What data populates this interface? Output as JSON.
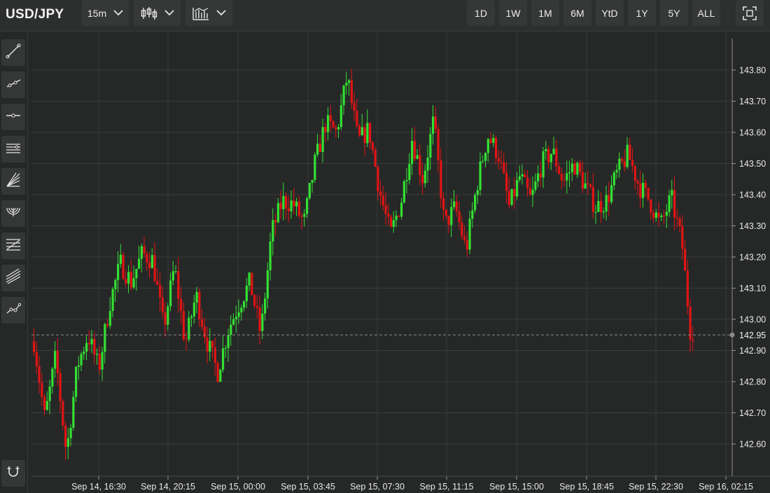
{
  "header": {
    "symbol": "USD/JPY",
    "interval": "15m",
    "chart_type_icon": "candlestick-icon",
    "indicators_icon": "indicators-icon",
    "ranges": [
      "1D",
      "1W",
      "1M",
      "6M",
      "YtD",
      "1Y",
      "5Y",
      "ALL"
    ],
    "fullscreen_icon": "fullscreen-icon"
  },
  "sidebar": {
    "tools": [
      "trend-line-icon",
      "ray-icon",
      "horizontal-line-icon",
      "parallel-channel-icon",
      "fan-icon",
      "arc-icon",
      "fib-retracement-icon",
      "pitchfork-icon",
      "path-icon"
    ],
    "bottom_tool": "magnet-icon"
  },
  "colors": {
    "background": "#262827",
    "up": "#33e033",
    "down": "#e01414",
    "grid": "#3b3d3c",
    "last_price_line": "#8a8a8a"
  },
  "chart_data": {
    "type": "candlestick",
    "symbol": "USD/JPY",
    "interval": "15m",
    "y_ticks": [
      "143.80",
      "143.70",
      "143.60",
      "143.50",
      "143.40",
      "143.30",
      "143.20",
      "143.10",
      "143.00",
      "142.90",
      "142.80",
      "142.70",
      "142.60"
    ],
    "ylim": [
      142.525,
      143.905
    ],
    "last_price": "142.95",
    "x_ticks": [
      "Sep 14, 16:30",
      "Sep 14, 20:15",
      "Sep 15, 00:00",
      "Sep 15, 03:45",
      "Sep 15, 07:30",
      "Sep 15, 11:15",
      "Sep 15, 15:00",
      "Sep 15, 18:45",
      "Sep 15, 22:30",
      "Sep 16, 02:15"
    ],
    "close_path": [
      142.93,
      142.68,
      142.88,
      142.57,
      142.85,
      142.95,
      142.84,
      143.05,
      143.18,
      143.12,
      143.21,
      143.19,
      142.97,
      143.17,
      142.92,
      143.08,
      142.93,
      142.83,
      142.97,
      143.05,
      143.12,
      142.95,
      143.28,
      143.38,
      143.37,
      143.31,
      143.5,
      143.63,
      143.6,
      143.78,
      143.57,
      143.61,
      143.41,
      143.27,
      143.38,
      143.58,
      143.45,
      143.64,
      143.3,
      143.36,
      143.22,
      143.43,
      143.59,
      143.53,
      143.36,
      143.46,
      143.38,
      143.5,
      143.54,
      143.44,
      143.5,
      143.43,
      143.36,
      143.38,
      143.47,
      143.53,
      143.43,
      143.38,
      143.3,
      143.39,
      143.24,
      142.88
    ]
  }
}
